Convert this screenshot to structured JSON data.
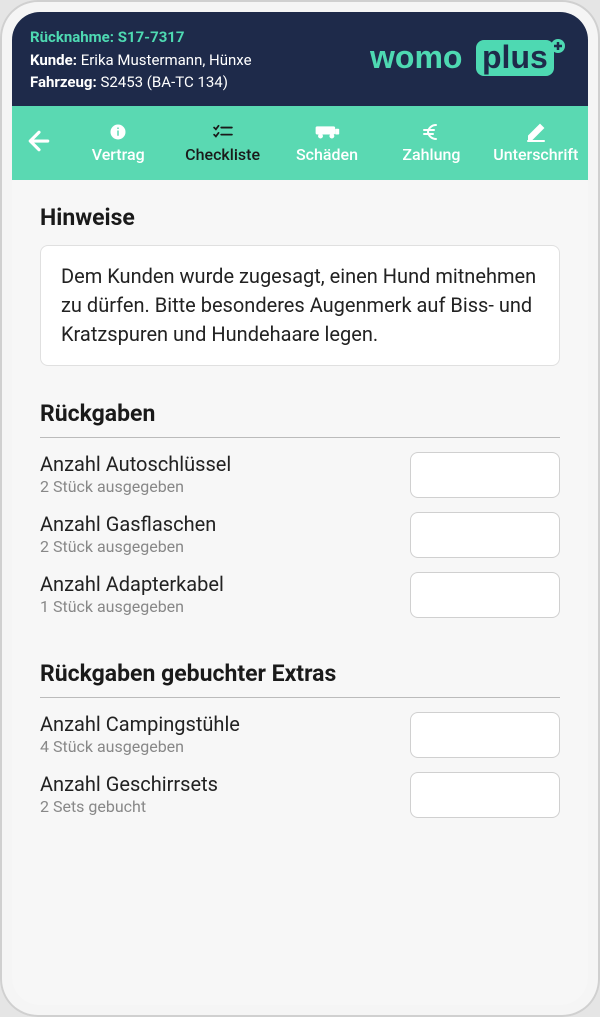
{
  "header": {
    "ruecknahme_label": "Rücknahme:",
    "ruecknahme_value": "S17-7317",
    "kunde_label": "Kunde:",
    "kunde_value": "Erika Mustermann, Hünxe",
    "fahrzeug_label": "Fahrzeug:",
    "fahrzeug_value": "S2453 (BA-TC 134)"
  },
  "logo": {
    "text1": "womo",
    "text2": "plus"
  },
  "tabs": {
    "vertrag": "Vertrag",
    "checkliste": "Checkliste",
    "schaeden": "Schäden",
    "zahlung": "Zahlung",
    "unterschrift": "Unterschrift"
  },
  "sections": {
    "hinweise_title": "Hinweise",
    "hinweise_text": "Dem Kunden wurde zugesagt, einen Hund mitnehmen zu dürfen. Bitte besonderes Augenmerk auf Biss- und Kratzspuren und Hundehaare legen.",
    "rueckgaben_title": "Rückgaben",
    "rueckgaben": [
      {
        "label": "Anzahl Autoschlüssel",
        "sub": "2 Stück ausgegeben"
      },
      {
        "label": "Anzahl Gasflaschen",
        "sub": "2 Stück ausgegeben"
      },
      {
        "label": "Anzahl Adapterkabel",
        "sub": "1 Stück ausgegeben"
      }
    ],
    "extras_title": "Rückgaben gebuchter Extras",
    "extras": [
      {
        "label": "Anzahl Campingstühle",
        "sub": "4 Stück ausgegeben"
      },
      {
        "label": "Anzahl Geschirrsets",
        "sub": "2 Sets gebucht"
      }
    ]
  }
}
